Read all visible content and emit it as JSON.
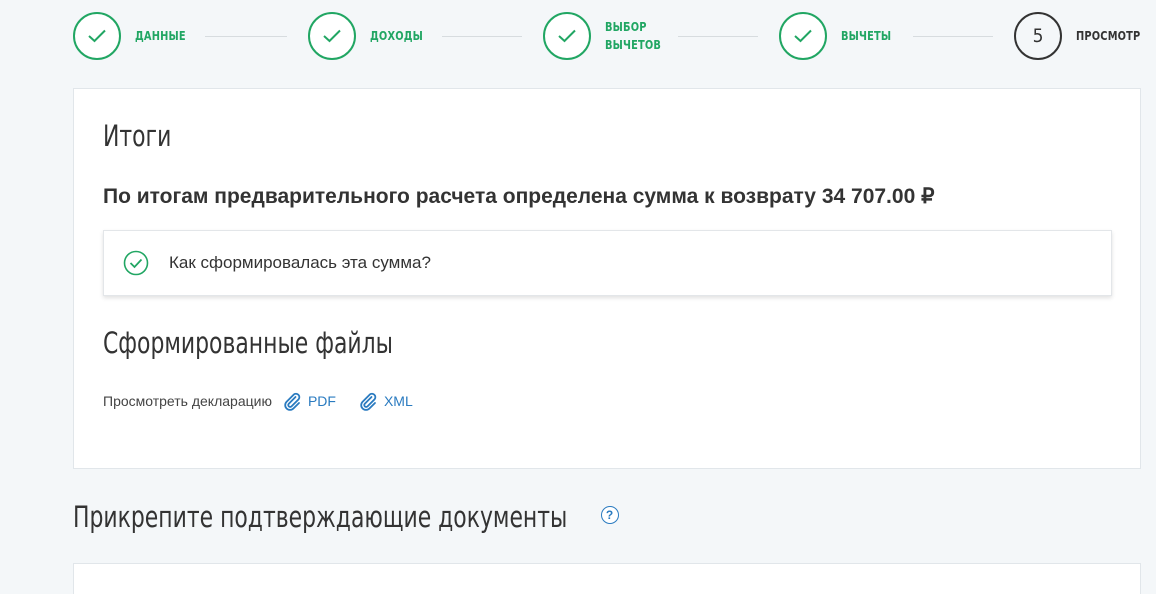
{
  "stepper": {
    "steps": [
      {
        "label_lines": [
          "ДАННЫЕ"
        ],
        "state": "done"
      },
      {
        "label_lines": [
          "ДОХОДЫ"
        ],
        "state": "done"
      },
      {
        "label_lines": [
          "ВЫБОР",
          "ВЫЧЕТОВ"
        ],
        "state": "done"
      },
      {
        "label_lines": [
          "ВЫЧЕТЫ"
        ],
        "state": "done"
      },
      {
        "label_lines": [
          "ПРОСМОТР"
        ],
        "state": "current",
        "number": "5"
      }
    ],
    "done_icon": "checkmark-icon"
  },
  "results": {
    "title": "Итоги",
    "summary": "По итогам предварительного расчета определена сумма к возврату 34 707.00 ₽",
    "accordion_label": "Как сформировалась эта сумма?",
    "files_title": "Сформированные файлы",
    "view_label": "Просмотреть декларацию",
    "links": [
      "PDF",
      "XML"
    ],
    "link_icon": "paperclip-icon"
  },
  "attach": {
    "title": "Прикрепите подтверждающие документы",
    "help_glyph": "?"
  },
  "colors": {
    "accent_green": "#21a663",
    "link_blue": "#2a7bc0",
    "text": "#333333",
    "background": "#f4f7f9"
  }
}
